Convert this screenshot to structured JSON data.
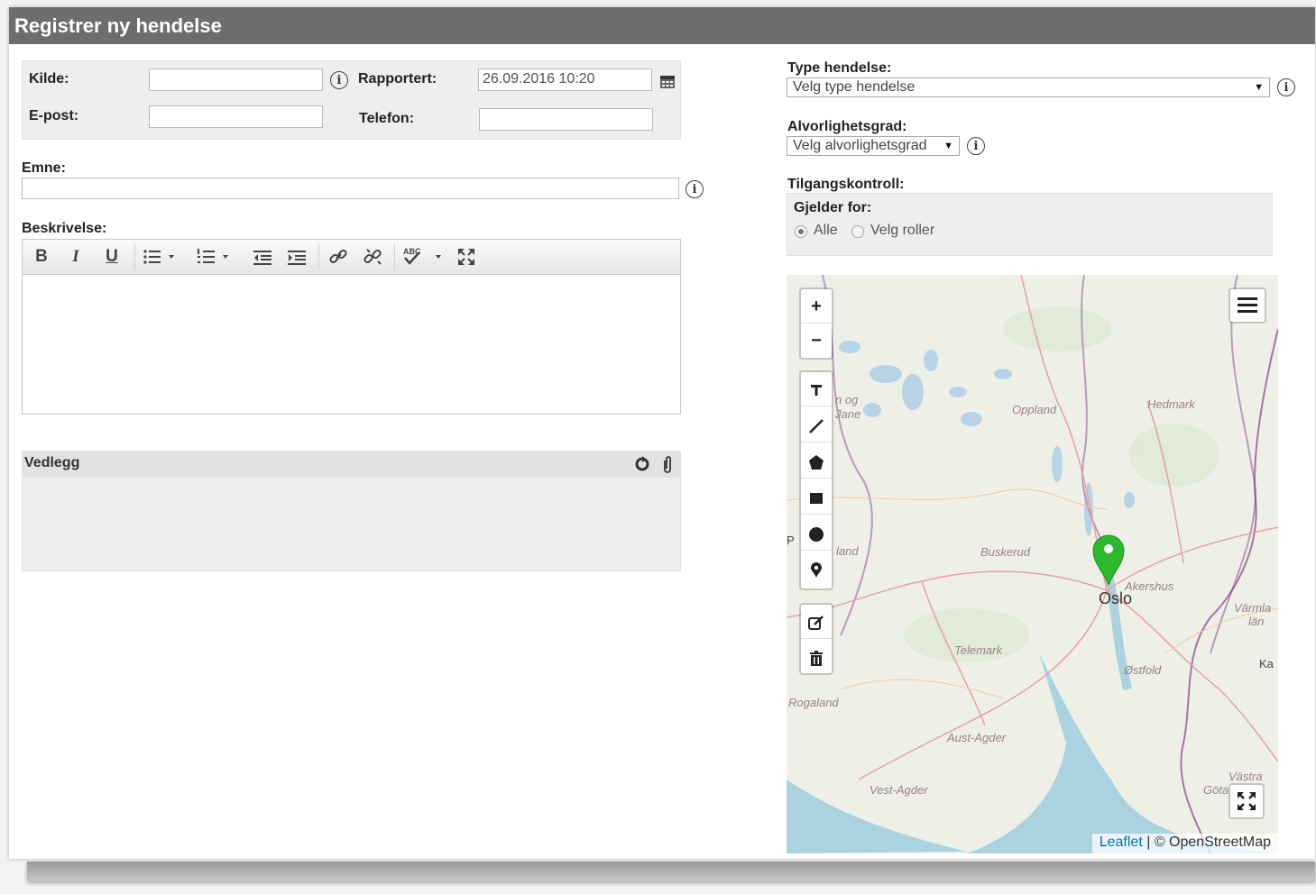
{
  "title": "Registrer ny hendelse",
  "contact": {
    "source_label": "Kilde:",
    "source_value": "",
    "reported_label": "Rapportert:",
    "reported_value": "26.09.2016 10:20",
    "email_label": "E-post:",
    "email_value": "",
    "phone_label": "Telefon:",
    "phone_value": ""
  },
  "subject": {
    "label": "Emne:",
    "value": ""
  },
  "description": {
    "label": "Beskrivelse:",
    "toolbar": [
      {
        "name": "bold-button",
        "glyph": "B"
      },
      {
        "name": "italic-button",
        "glyph": "I"
      },
      {
        "name": "underline-button",
        "glyph": "U"
      },
      {
        "name": "bullet-list-button",
        "glyph": "☰"
      },
      {
        "name": "numbered-list-button",
        "glyph": "☷"
      },
      {
        "name": "outdent-button",
        "glyph": "⇤"
      },
      {
        "name": "indent-button",
        "glyph": "⇥"
      },
      {
        "name": "link-button",
        "glyph": "🔗"
      },
      {
        "name": "unlink-button",
        "glyph": "⛓"
      },
      {
        "name": "spellcheck-button",
        "glyph": "ABC"
      },
      {
        "name": "fullscreen-button",
        "glyph": "⛶"
      }
    ]
  },
  "attachments": {
    "label": "Vedlegg"
  },
  "event_type": {
    "label": "Type hendelse:",
    "selected": "Velg type hendelse"
  },
  "severity": {
    "label": "Alvorlighetsgrad:",
    "selected": "Velg alvorlighetsgrad"
  },
  "access": {
    "label": "Tilgangskontroll:",
    "applies_label": "Gjelder for:",
    "option_all": "Alle",
    "option_roles": "Velg roller",
    "selected": "Alle"
  },
  "map": {
    "places": {
      "oppland": "Oppland",
      "hedmark": "Hedmark",
      "buskerud": "Buskerud",
      "akershus": "Akershus",
      "oslo": "Oslo",
      "telemark": "Telemark",
      "ostfold": "Østfold",
      "vermland": "Värmla",
      "vermland2": "län",
      "rogaland": "Rogaland",
      "aust_agder": "Aust-Agder",
      "vest_agder": "Vest-Agder",
      "vastra": "Västra",
      "gota": "Göta",
      "ka": "Ka",
      "sogn": "n og",
      "sogn2": "Jane",
      "land": "land",
      "p": "P"
    },
    "zoom_in": "+",
    "zoom_out": "−",
    "attribution_link": "Leaflet",
    "attribution_text": " | © OpenStreetMap",
    "marker_color": "#2db82d"
  },
  "colors": {
    "titlebar": "#6d6d6d",
    "panel": "#eeeeee",
    "link": "#0078a8"
  }
}
